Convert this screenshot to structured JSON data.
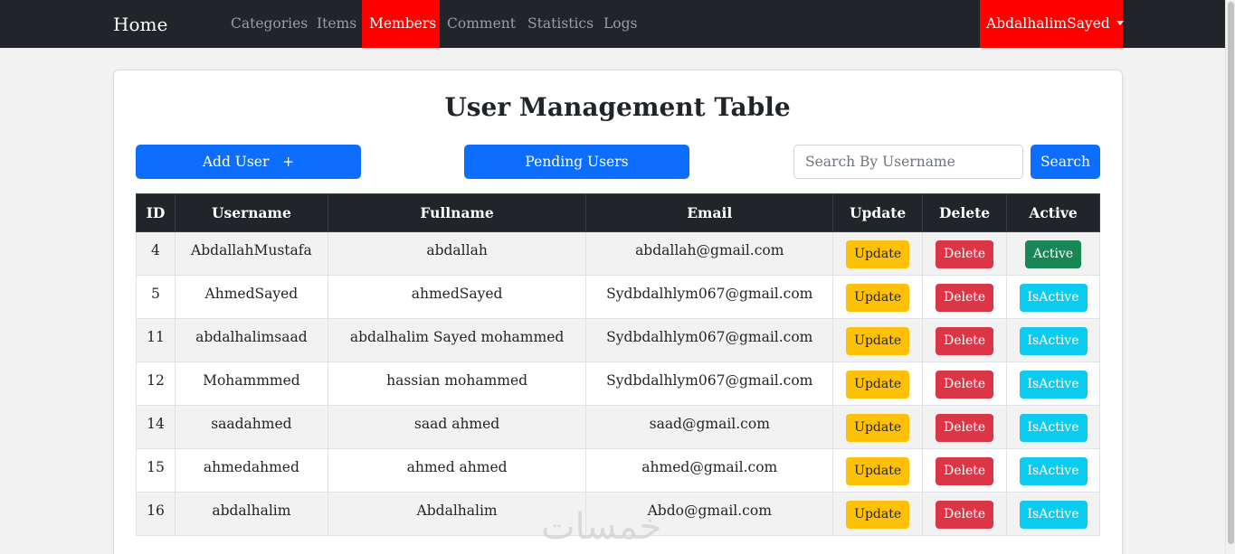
{
  "nav": {
    "brand": "Home",
    "items": [
      "Categories",
      "Items",
      "Members",
      "Comment",
      "Statistics",
      "Logs"
    ],
    "active_item": "Members",
    "user": "AbdalhalimSayed"
  },
  "page": {
    "title": "User Management Table",
    "add_user_label": "Add User   +",
    "pending_label": "Pending Users",
    "search_placeholder": "Search By Username",
    "search_label": "Search"
  },
  "table": {
    "headers": [
      "ID",
      "Username",
      "Fullname",
      "Email",
      "Update",
      "Delete",
      "Active"
    ],
    "rows": [
      {
        "id": "4",
        "username": "AbdallahMustafa",
        "fullname": "abdallah",
        "email": "abdallah@gmail.com",
        "update": "Update",
        "delete": "Delete",
        "active": "Active",
        "active_state": "active"
      },
      {
        "id": "5",
        "username": "AhmedSayed",
        "fullname": "ahmedSayed",
        "email": "Sydbdalhlym067@gmail.com",
        "update": "Update",
        "delete": "Delete",
        "active": "IsActive",
        "active_state": "inactive"
      },
      {
        "id": "11",
        "username": "abdalhalimsaad",
        "fullname": "abdalhalim Sayed mohammed",
        "email": "Sydbdalhlym067@gmail.com",
        "update": "Update",
        "delete": "Delete",
        "active": "IsActive",
        "active_state": "inactive"
      },
      {
        "id": "12",
        "username": "Mohammmed",
        "fullname": "hassian mohammed",
        "email": "Sydbdalhlym067@gmail.com",
        "update": "Update",
        "delete": "Delete",
        "active": "IsActive",
        "active_state": "inactive"
      },
      {
        "id": "14",
        "username": "saadahmed",
        "fullname": "saad ahmed",
        "email": "saad@gmail.com",
        "update": "Update",
        "delete": "Delete",
        "active": "IsActive",
        "active_state": "inactive"
      },
      {
        "id": "15",
        "username": "ahmedahmed",
        "fullname": "ahmed ahmed",
        "email": "ahmed@gmail.com",
        "update": "Update",
        "delete": "Delete",
        "active": "IsActive",
        "active_state": "inactive"
      },
      {
        "id": "16",
        "username": "abdalhalim",
        "fullname": "Abdalhalim",
        "email": "Abdo@gmail.com",
        "update": "Update",
        "delete": "Delete",
        "active": "IsActive",
        "active_state": "inactive"
      }
    ]
  },
  "watermark": "خمسات",
  "colors": {
    "navbar_bg": "#212529",
    "nav_active": "#ff0000",
    "primary": "#0d6efd",
    "update": "#ffc107",
    "delete": "#dc3545",
    "active": "#198754",
    "isactive": "#0dcaf0"
  }
}
